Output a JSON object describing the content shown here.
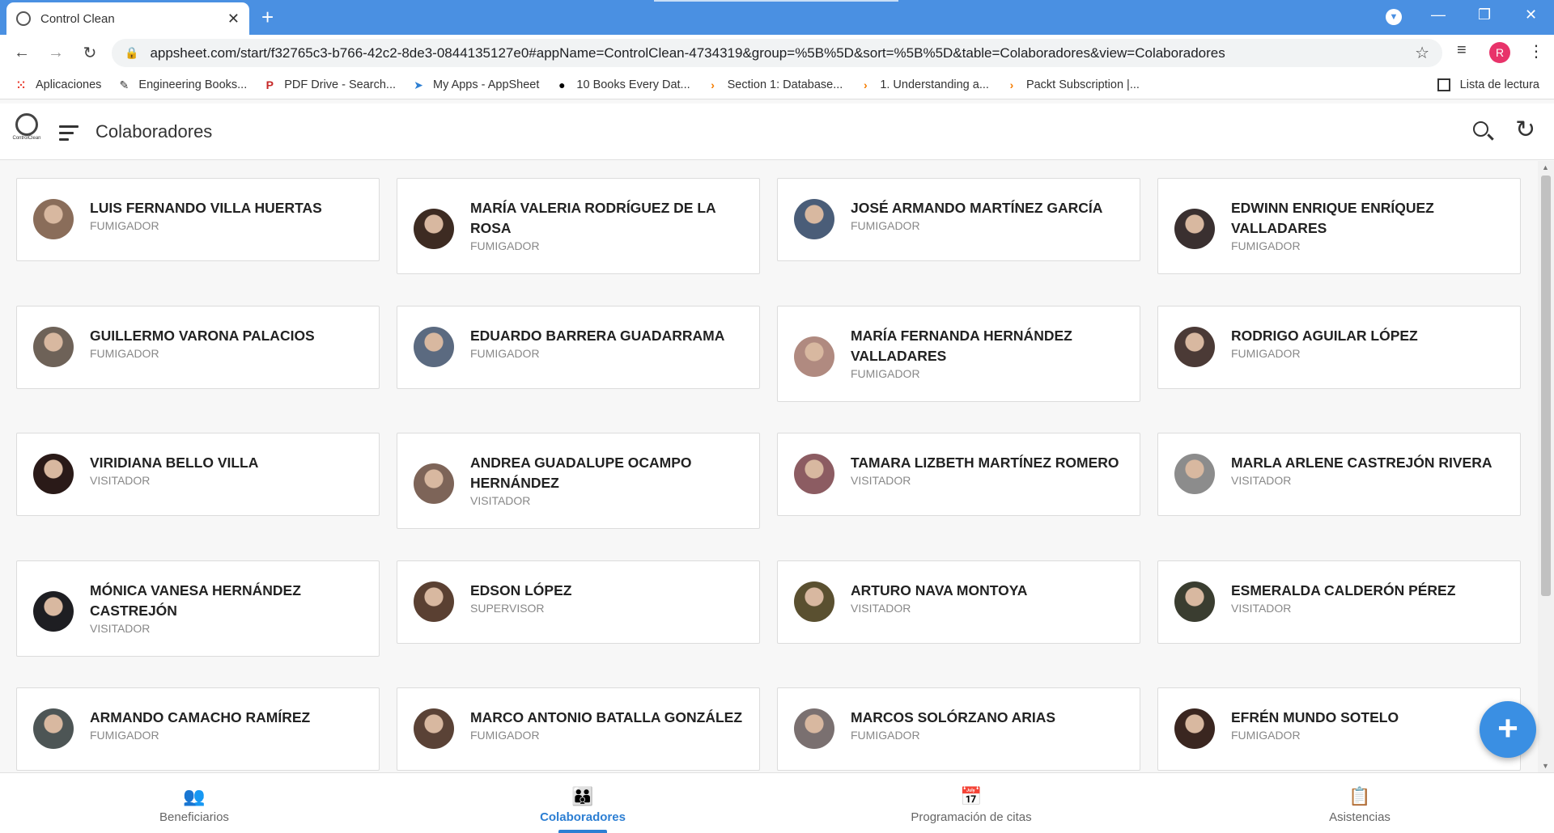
{
  "browser": {
    "tab_title": "Control Clean",
    "url": "appsheet.com/start/f32765c3-b766-42c2-8de3-0844135127e0#appName=ControlClean-4734319&group=%5B%5D&sort=%5B%5D&table=Colaboradores&view=Colaboradores",
    "profile_initial": "R",
    "bookmarks": [
      {
        "label": "Aplicaciones",
        "icon": "apps-grid-icon",
        "color": "#e94235"
      },
      {
        "label": "Engineering Books...",
        "icon": "book-icon",
        "color": "#333333"
      },
      {
        "label": "PDF Drive - Search...",
        "icon": "pdf-drive-icon",
        "color": "#c62828"
      },
      {
        "label": "My Apps - AppSheet",
        "icon": "appsheet-icon",
        "color": "#2d7fd3"
      },
      {
        "label": "10 Books Every Dat...",
        "icon": "medium-icon",
        "color": "#000000"
      },
      {
        "label": "Section 1: Database...",
        "icon": "packt-icon",
        "color": "#f57c00"
      },
      {
        "label": "1. Understanding a...",
        "icon": "packt-icon",
        "color": "#f57c00"
      },
      {
        "label": "Packt Subscription |...",
        "icon": "packt-icon",
        "color": "#f57c00"
      }
    ],
    "reading_list": "Lista de lectura"
  },
  "app": {
    "logo_text": "ControlClean",
    "title": "Colaboradores",
    "accent": "#2d7fd3"
  },
  "collaborators": [
    {
      "name": "LUIS FERNANDO VILLA HUERTAS",
      "role": "FUMIGADOR",
      "tone": "#8a6d5a"
    },
    {
      "name": "MARÍA VALERIA RODRÍGUEZ DE LA ROSA",
      "role": "FUMIGADOR",
      "tone": "#3d2b22"
    },
    {
      "name": "JOSÉ ARMANDO MARTÍNEZ GARCÍA",
      "role": "FUMIGADOR",
      "tone": "#4a5d78"
    },
    {
      "name": "EDWINN ENRIQUE ENRÍQUEZ VALLADARES",
      "role": "FUMIGADOR",
      "tone": "#3a3030"
    },
    {
      "name": "GUILLERMO VARONA PALACIOS",
      "role": "FUMIGADOR",
      "tone": "#6e6258"
    },
    {
      "name": "EDUARDO BARRERA GUADARRAMA",
      "role": "FUMIGADOR",
      "tone": "#5b6a80"
    },
    {
      "name": "MARÍA FERNANDA HERNÁNDEZ VALLADARES",
      "role": "FUMIGADOR",
      "tone": "#b08a80"
    },
    {
      "name": "RODRIGO AGUILAR LÓPEZ",
      "role": "FUMIGADOR",
      "tone": "#4b3a36"
    },
    {
      "name": "VIRIDIANA BELLO VILLA",
      "role": "VISITADOR",
      "tone": "#2a1a18"
    },
    {
      "name": "ANDREA GUADALUPE OCAMPO HERNÁNDEZ",
      "role": "VISITADOR",
      "tone": "#7d6458"
    },
    {
      "name": "TAMARA LIZBETH MARTÍNEZ ROMERO",
      "role": "VISITADOR",
      "tone": "#8c5c62"
    },
    {
      "name": "MARLA ARLENE CASTREJÓN RIVERA",
      "role": "VISITADOR",
      "tone": "#8c8c8c"
    },
    {
      "name": "MÓNICA VANESA HERNÁNDEZ CASTREJÓN",
      "role": "VISITADOR",
      "tone": "#1e1e22"
    },
    {
      "name": "EDSON LÓPEZ",
      "role": "SUPERVISOR",
      "tone": "#5a4032"
    },
    {
      "name": "ARTURO NAVA MONTOYA",
      "role": "VISITADOR",
      "tone": "#5a5030"
    },
    {
      "name": "ESMERALDA CALDERÓN PÉREZ",
      "role": "VISITADOR",
      "tone": "#3a3d30"
    },
    {
      "name": "ARMANDO CAMACHO RAMÍREZ",
      "role": "FUMIGADOR",
      "tone": "#4d5555"
    },
    {
      "name": "MARCO ANTONIO BATALLA GONZÁLEZ",
      "role": "FUMIGADOR",
      "tone": "#5a4236"
    },
    {
      "name": "MARCOS SOLÓRZANO ARIAS",
      "role": "FUMIGADOR",
      "tone": "#7a7070"
    },
    {
      "name": "EFRÉN MUNDO SOTELO",
      "role": "FUMIGADOR",
      "tone": "#3a2620"
    }
  ],
  "bottom_nav": [
    {
      "label": "Beneficiarios",
      "icon": "people-icon",
      "glyph": "👥",
      "active": false
    },
    {
      "label": "Colaboradores",
      "icon": "team-icon",
      "glyph": "👪",
      "active": true
    },
    {
      "label": "Programación de citas",
      "icon": "calendar-icon",
      "glyph": "📅",
      "active": false
    },
    {
      "label": "Asistencias",
      "icon": "list-icon",
      "glyph": "📋",
      "active": false
    }
  ],
  "fab_label": "+"
}
